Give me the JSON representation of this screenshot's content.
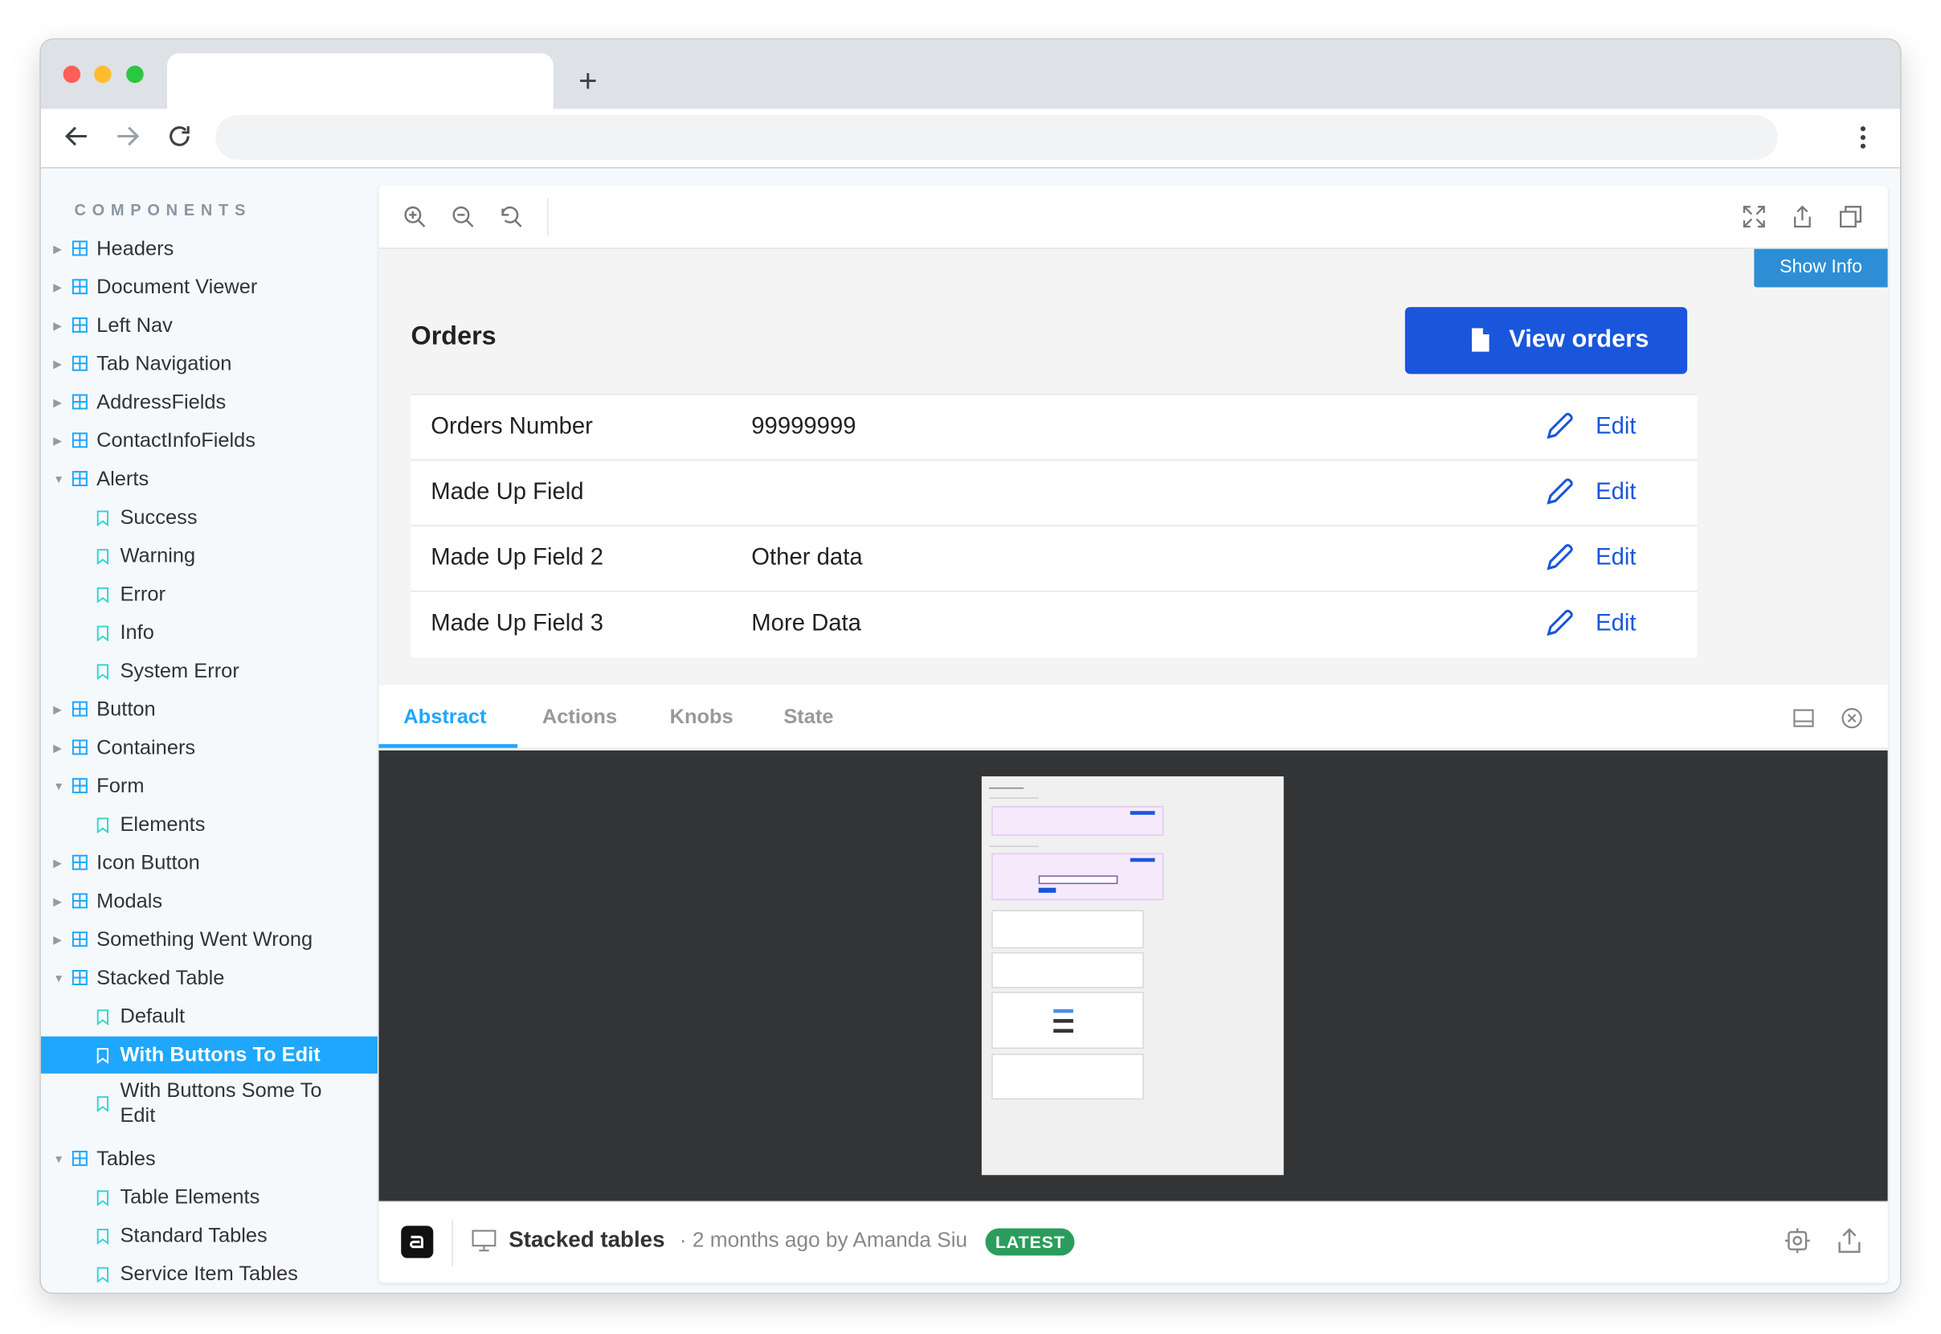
{
  "sidebar": {
    "heading": "COMPONENTS",
    "items": [
      {
        "label": "Headers",
        "kind": "group",
        "expanded": false
      },
      {
        "label": "Document Viewer",
        "kind": "group",
        "expanded": false
      },
      {
        "label": "Left Nav",
        "kind": "group",
        "expanded": false
      },
      {
        "label": "Tab Navigation",
        "kind": "group",
        "expanded": false
      },
      {
        "label": "AddressFields",
        "kind": "group",
        "expanded": false
      },
      {
        "label": "ContactInfoFields",
        "kind": "group",
        "expanded": false
      },
      {
        "label": "Alerts",
        "kind": "group",
        "expanded": true
      },
      {
        "label": "Success",
        "kind": "story"
      },
      {
        "label": "Warning",
        "kind": "story"
      },
      {
        "label": "Error",
        "kind": "story"
      },
      {
        "label": "Info",
        "kind": "story"
      },
      {
        "label": "System Error",
        "kind": "story"
      },
      {
        "label": "Button",
        "kind": "group",
        "expanded": false
      },
      {
        "label": "Containers",
        "kind": "group",
        "expanded": false
      },
      {
        "label": "Form",
        "kind": "group",
        "expanded": true
      },
      {
        "label": "Elements",
        "kind": "story"
      },
      {
        "label": "Icon Button",
        "kind": "group",
        "expanded": false
      },
      {
        "label": "Modals",
        "kind": "group",
        "expanded": false
      },
      {
        "label": "Something Went Wrong",
        "kind": "group",
        "expanded": false
      },
      {
        "label": "Stacked Table",
        "kind": "group",
        "expanded": true
      },
      {
        "label": "Default",
        "kind": "story"
      },
      {
        "label": "With Buttons To Edit",
        "kind": "story",
        "selected": true
      },
      {
        "label": "With Buttons Some To Edit",
        "kind": "story"
      },
      {
        "label": "Tables",
        "kind": "group",
        "expanded": true
      },
      {
        "label": "Table Elements",
        "kind": "story"
      },
      {
        "label": "Standard Tables",
        "kind": "story"
      },
      {
        "label": "Service Item Tables",
        "kind": "story"
      }
    ]
  },
  "preview": {
    "show_info_label": "Show Info",
    "orders_title": "Orders",
    "view_orders_label": "View orders",
    "rows": [
      {
        "field": "Orders Number",
        "value": "99999999",
        "action": "Edit"
      },
      {
        "field": "Made Up Field",
        "value": "",
        "action": "Edit"
      },
      {
        "field": "Made Up Field 2",
        "value": "Other data",
        "action": "Edit"
      },
      {
        "field": "Made Up Field 3",
        "value": "More Data",
        "action": "Edit"
      }
    ]
  },
  "addons": {
    "tabs": [
      "Abstract",
      "Actions",
      "Knobs",
      "State"
    ],
    "active_tab": "Abstract"
  },
  "footer": {
    "title": "Stacked tables",
    "meta": "· 2 months ago by Amanda Siu",
    "badge": "LATEST"
  },
  "colors": {
    "accent": "#1ea7fd",
    "primary_button": "#1a56db",
    "latest_badge": "#2a9d5c",
    "show_info": "#2d8ed6"
  }
}
